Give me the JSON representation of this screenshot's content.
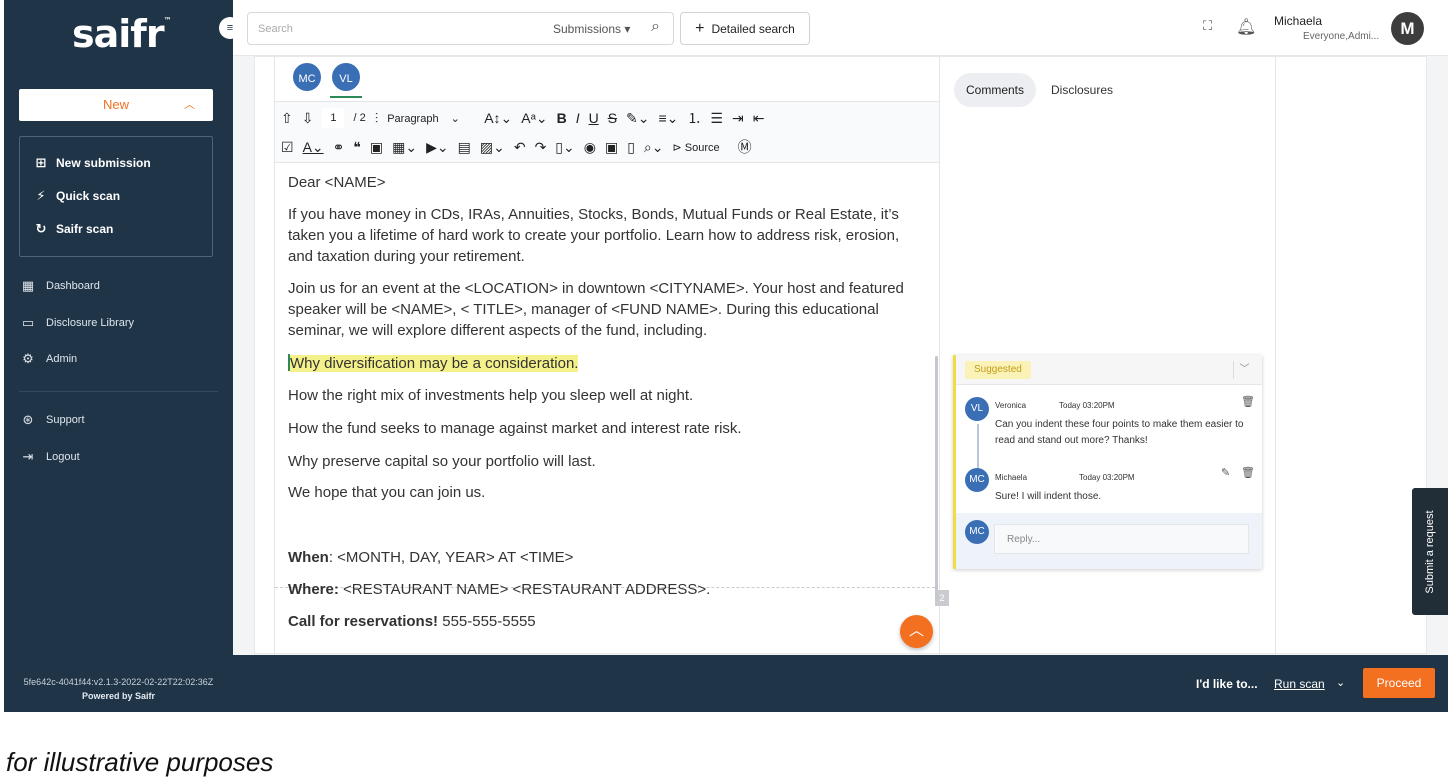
{
  "sidebar": {
    "logo": "saifr",
    "logo_tm": "™",
    "collapse_icon": "≡",
    "new_label": "New",
    "new_items": [
      {
        "label": "New submission",
        "icon": "new-submission-icon",
        "glyph": "⊞"
      },
      {
        "label": "Quick scan",
        "icon": "lightning-icon",
        "glyph": "⚡"
      },
      {
        "label": "Saifr scan",
        "icon": "saifr-scan-icon",
        "glyph": "↻"
      }
    ],
    "nav": [
      {
        "label": "Dashboard",
        "icon": "dashboard-icon",
        "glyph": "▦"
      },
      {
        "label": "Disclosure Library",
        "icon": "folder-icon",
        "glyph": "▭"
      },
      {
        "label": "Admin",
        "icon": "admin-icon",
        "glyph": "⚙"
      },
      {
        "label": "Support",
        "icon": "support-icon",
        "glyph": "⊛"
      },
      {
        "label": "Logout",
        "icon": "logout-icon",
        "glyph": "⇥"
      }
    ],
    "version": "5fe642c-4041f44:v2.1.3-2022-02-22T22:02:36Z",
    "powered": "Powered by Saifr"
  },
  "topbar": {
    "search_placeholder": "Search",
    "scope": "Submissions ▾",
    "detailed_search": "Detailed search",
    "user_name": "Michaela",
    "user_roles": "Everyone,Admi...",
    "user_initial": "M"
  },
  "editor": {
    "collaborators": [
      "MC",
      "VL"
    ],
    "toolbar": {
      "page_current": "1",
      "page_total": "/ 2",
      "paragraph_style": "Paragraph",
      "source_label": "Source"
    },
    "paragraphs": [
      "Dear <NAME>",
      "If you have money in CDs, IRAs, Annuities, Stocks, Bonds, Mutual Funds or Real Estate, it’s taken you a lifetime of hard work to create your portfolio. Learn how to address risk, erosion, and taxation during your retirement.",
      "Join us for an event at the <LOCATION> in downtown <CITYNAME>.  Your host and featured speaker will be <NAME>, < TITLE>, manager of <FUND NAME>.  During this educational seminar, we will explore different aspects of the fund, including.",
      "Why diversification may be a consideration.",
      "How the right mix of investments help you sleep well at night.",
      "How the fund seeks to manage against market and interest rate risk.",
      "Why preserve capital so your portfolio will last.",
      "We hope that you can join us."
    ],
    "details": {
      "when_label": "When",
      "when_value": ": <MONTH, DAY, YEAR> AT <TIME>",
      "where_label": "Where:",
      "where_value": " <RESTAURANT NAME> <RESTAURANT ADDRESS>.",
      "call_label": "Call for reservations!",
      "call_value": " 555-555-5555"
    },
    "page_marker": "2"
  },
  "comments": {
    "tabs": [
      "Comments",
      "Disclosures"
    ],
    "status": "Suggested",
    "thread": [
      {
        "initials": "VL",
        "name": "Veronica",
        "time": "Today 03:20PM",
        "text": "Can you indent these four points to make them easier to read and stand out more? Thanks!"
      },
      {
        "initials": "MC",
        "name": "Michaela",
        "time": "Today 03:20PM",
        "text": "Sure! I will indent those."
      }
    ],
    "reply_initials": "MC",
    "reply_placeholder": "Reply..."
  },
  "submit_request": "Submit a request",
  "bottombar": {
    "id_like": "I'd like to...",
    "run_scan": "Run scan",
    "proceed": "Proceed"
  },
  "caption": "for illustrative purposes",
  "colors": {
    "sidebar_bg": "#1f3447",
    "accent_orange": "#f37021",
    "highlight_yellow": "#f4f08a",
    "avatar_blue": "#3b6fb5"
  }
}
